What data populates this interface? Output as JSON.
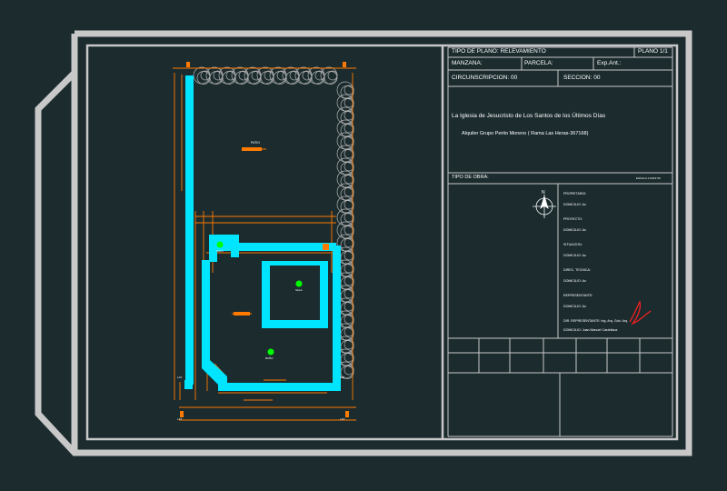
{
  "title_block": {
    "tipo_plano": "TIPO DE PLANO: RELEVAMIENTO",
    "plano_num": "PLANO 1/1",
    "manzana": "MANZANA:",
    "parcela": "PARCELA:",
    "exp": "Exp.Ant.:",
    "circunscripcion": "CIRCUNSCRIPCION: 00",
    "seccion": "SECCION: 00",
    "church_name": "La Iglesia de Jesucristo de Los Santos de los Últimos Días",
    "alquiler": "Alquiler Grupo Perito Moreno ( Rama Las Heras-367168)",
    "tipo_obra": "TIPO DE OBRA:",
    "escala": "ESCALA 1:100/1:50",
    "fields": [
      "PROPIETARIO:",
      "DOMICILIO: Av.",
      "PROYECTO:",
      "DOMICILIO: Av.",
      "SITUACION:",
      "DOMICILIO: Av.",
      "DIREC. TECNICA:",
      "DOMICILIO: Av.",
      "REPRESENTANTE:",
      "DOMICILIO: Av.",
      "DIR. REPRESENTANTE: Ing. Arq. Gob. Arq.",
      "DOMICILIO: Juan Manuel Castellana"
    ]
  },
  "plan": {
    "patio_label": "PATIO",
    "room_labels": [
      "SALA",
      "SALA",
      "BAÑO"
    ],
    "axis_labels": [
      "LAT.",
      "LAT.",
      "LAT.",
      "LAT."
    ]
  },
  "colors": {
    "background": "#1b2b2e",
    "frame": "#c8c8c8",
    "sheet": "#1b2b2e",
    "wall": "#00e5ff",
    "dimension": "#ff7a00",
    "tree": "#b4b4b4",
    "node": "#00ff00",
    "signature": "#ff2020"
  }
}
